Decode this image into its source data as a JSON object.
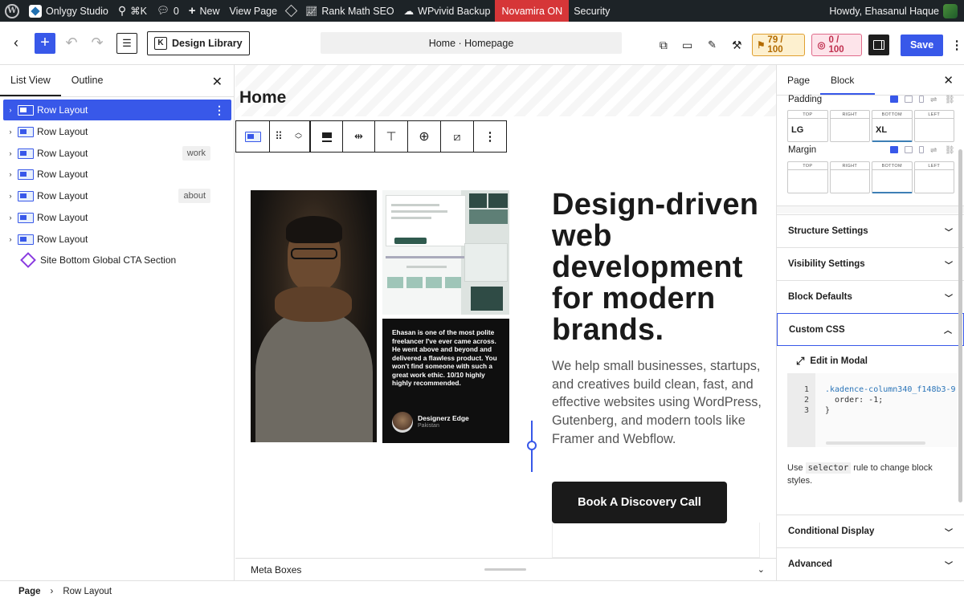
{
  "adminbar": {
    "site_name": "Onlygy Studio",
    "search_shortcut": "⌘K",
    "comments_count": "0",
    "new_label": "New",
    "view_page": "View Page",
    "rank_math": "Rank Math SEO",
    "wpvivid": "WPvivid Backup",
    "novamira": "Novamira ON",
    "security": "Security",
    "howdy": "Howdy, Ehasanul Haque"
  },
  "header": {
    "design_library": "Design Library",
    "document_title": "Home · Homepage",
    "score_readability": "79 / 100",
    "score_seo": "0 / 100",
    "save_label": "Save"
  },
  "list_panel": {
    "tabs": [
      "List View",
      "Outline"
    ],
    "rows": [
      {
        "label": "Row Layout",
        "anchor": ""
      },
      {
        "label": "Row Layout",
        "anchor": ""
      },
      {
        "label": "Row Layout",
        "anchor": "work"
      },
      {
        "label": "Row Layout",
        "anchor": ""
      },
      {
        "label": "Row Layout",
        "anchor": "about"
      },
      {
        "label": "Row Layout",
        "anchor": ""
      },
      {
        "label": "Row Layout",
        "anchor": ""
      }
    ],
    "cta_label": "Site Bottom Global CTA Section"
  },
  "canvas": {
    "page_title": "Home",
    "hero_heading": "Design-driven web development for modern brands.",
    "hero_text": "We help small businesses, startups, and creatives build clean, fast, and effective websites using WordPress, Gutenberg, and modern tools like Framer and Webflow.",
    "cta_button": "Book A Discovery Call",
    "testimonial_quote": "Ehasan is one of the most polite freelancer I've ever came across. He went above and beyond and delivered a flawless product. You won't find someone with such a great work ethic. 10/10 highly highly recommended.",
    "testimonial_name": "Designerz Edge",
    "testimonial_location": "Pakistan",
    "meta_boxes": "Meta Boxes"
  },
  "inspector": {
    "tabs": [
      "Page",
      "Block"
    ],
    "padding_label": "Padding",
    "margin_label": "Margin",
    "side_captions": [
      "TOP",
      "RIGHT",
      "BOTTOM",
      "LEFT"
    ],
    "padding_values": [
      "LG",
      "",
      "XL",
      ""
    ],
    "sections": {
      "structure": "Structure Settings",
      "visibility": "Visibility Settings",
      "defaults": "Block Defaults",
      "custom_css": "Custom CSS",
      "conditional": "Conditional Display",
      "advanced": "Advanced"
    },
    "edit_in_modal": "Edit in Modal",
    "code_lines": [
      ".kadence-column340_f148b3-9",
      "  order: -1;",
      "}"
    ],
    "help_prefix": "Use",
    "help_code": "selector",
    "help_suffix": "rule to change block styles."
  },
  "footer": {
    "crumbs": [
      "Page",
      "Row Layout"
    ]
  },
  "colors": {
    "accent": "#3858e9",
    "admin_bar": "#1d2327",
    "novamira": "#d63638"
  }
}
